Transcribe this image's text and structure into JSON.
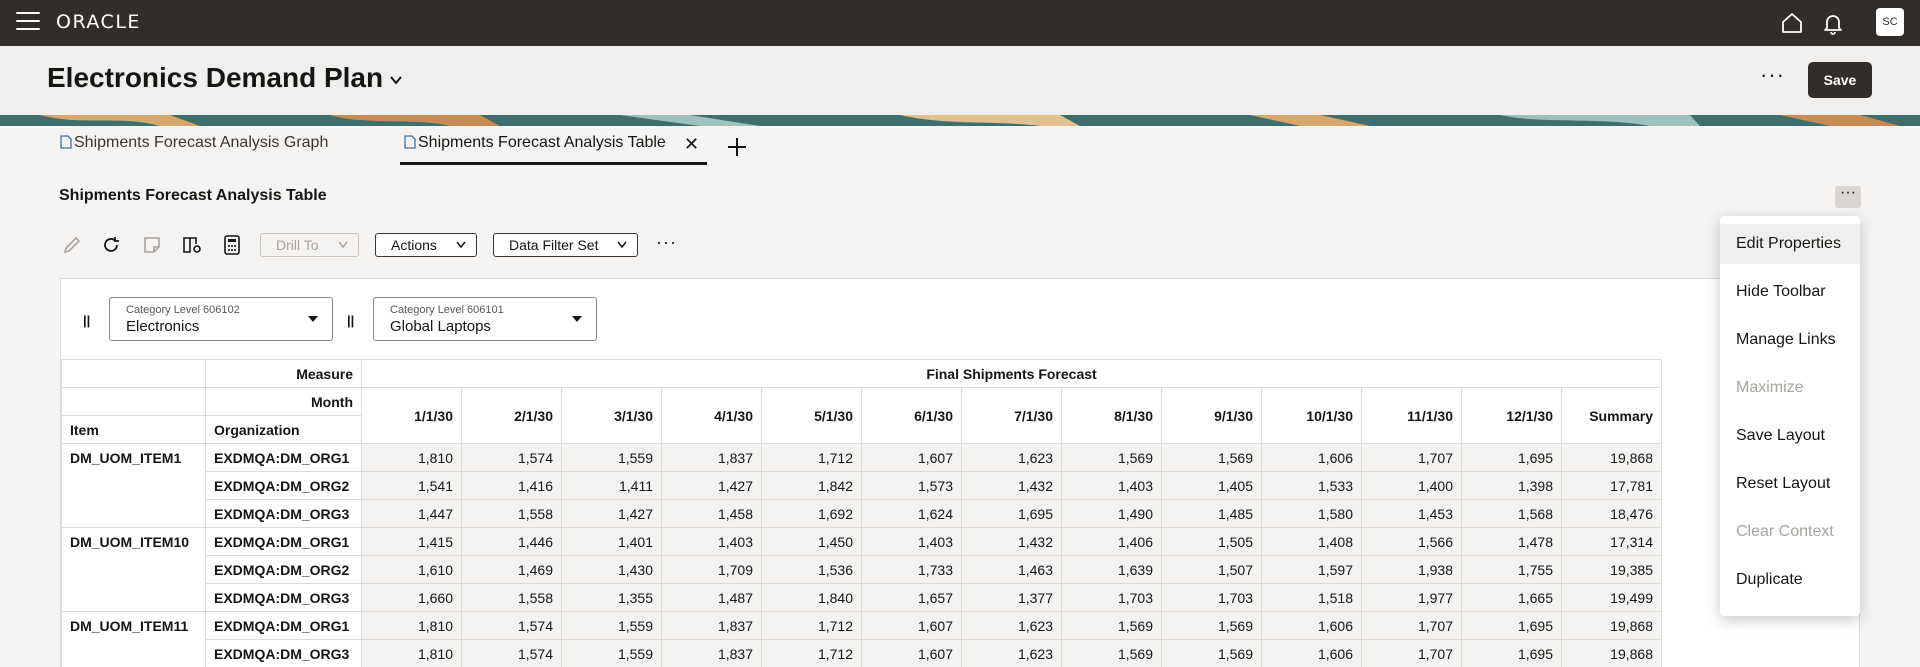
{
  "app": {
    "logo": "ORACLE",
    "user_initials": "SC"
  },
  "header": {
    "title": "Electronics Demand Plan",
    "save_label": "Save"
  },
  "tabs": [
    {
      "label": "Shipments Forecast Analysis Graph"
    },
    {
      "label": "Shipments Forecast Analysis Table"
    }
  ],
  "section": {
    "title": "Shipments Forecast Analysis Table"
  },
  "toolbar": {
    "drill_to": "Drill To",
    "actions": "Actions",
    "data_filter_set": "Data Filter Set"
  },
  "filters": [
    {
      "label": "Category Level 606102",
      "value": "Electronics"
    },
    {
      "label": "Category Level 606101",
      "value": "Global Laptops"
    }
  ],
  "table": {
    "measure_label": "Measure",
    "month_label": "Month",
    "item_label": "Item",
    "org_label": "Organization",
    "measure_name": "Final Shipments Forecast",
    "months": [
      "1/1/30",
      "2/1/30",
      "3/1/30",
      "4/1/30",
      "5/1/30",
      "6/1/30",
      "7/1/30",
      "8/1/30",
      "9/1/30",
      "10/1/30",
      "11/1/30",
      "12/1/30",
      "Summary"
    ],
    "groups": [
      {
        "item": "DM_UOM_ITEM1",
        "rows": [
          {
            "org": "EXDMQA:DM_ORG1",
            "values": [
              "1,810",
              "1,574",
              "1,559",
              "1,837",
              "1,712",
              "1,607",
              "1,623",
              "1,569",
              "1,569",
              "1,606",
              "1,707",
              "1,695",
              "19,868"
            ]
          },
          {
            "org": "EXDMQA:DM_ORG2",
            "values": [
              "1,541",
              "1,416",
              "1,411",
              "1,427",
              "1,842",
              "1,573",
              "1,432",
              "1,403",
              "1,405",
              "1,533",
              "1,400",
              "1,398",
              "17,781"
            ]
          },
          {
            "org": "EXDMQA:DM_ORG3",
            "values": [
              "1,447",
              "1,558",
              "1,427",
              "1,458",
              "1,692",
              "1,624",
              "1,695",
              "1,490",
              "1,485",
              "1,580",
              "1,453",
              "1,568",
              "18,476"
            ]
          }
        ]
      },
      {
        "item": "DM_UOM_ITEM10",
        "rows": [
          {
            "org": "EXDMQA:DM_ORG1",
            "values": [
              "1,415",
              "1,446",
              "1,401",
              "1,403",
              "1,450",
              "1,403",
              "1,432",
              "1,406",
              "1,505",
              "1,408",
              "1,566",
              "1,478",
              "17,314"
            ]
          },
          {
            "org": "EXDMQA:DM_ORG2",
            "values": [
              "1,610",
              "1,469",
              "1,430",
              "1,709",
              "1,536",
              "1,733",
              "1,463",
              "1,639",
              "1,507",
              "1,597",
              "1,938",
              "1,755",
              "19,385"
            ]
          },
          {
            "org": "EXDMQA:DM_ORG3",
            "values": [
              "1,660",
              "1,558",
              "1,355",
              "1,487",
              "1,840",
              "1,657",
              "1,377",
              "1,703",
              "1,703",
              "1,518",
              "1,977",
              "1,665",
              "19,499"
            ]
          }
        ]
      },
      {
        "item": "DM_UOM_ITEM11",
        "rows": [
          {
            "org": "EXDMQA:DM_ORG1",
            "values": [
              "1,810",
              "1,574",
              "1,559",
              "1,837",
              "1,712",
              "1,607",
              "1,623",
              "1,569",
              "1,569",
              "1,606",
              "1,707",
              "1,695",
              "19,868"
            ]
          },
          {
            "org": "EXDMQA:DM_ORG3",
            "values": [
              "1,810",
              "1,574",
              "1,559",
              "1,837",
              "1,712",
              "1,607",
              "1,623",
              "1,569",
              "1,569",
              "1,606",
              "1,707",
              "1,695",
              "19,868"
            ]
          }
        ]
      }
    ]
  },
  "menu": {
    "items": [
      {
        "label": "Edit Properties",
        "state": "hover"
      },
      {
        "label": "Hide Toolbar",
        "state": "enabled"
      },
      {
        "label": "Manage Links",
        "state": "enabled"
      },
      {
        "label": "Maximize",
        "state": "disabled"
      },
      {
        "label": "Save Layout",
        "state": "enabled"
      },
      {
        "label": "Reset Layout",
        "state": "enabled"
      },
      {
        "label": "Clear Context",
        "state": "disabled"
      },
      {
        "label": "Duplicate",
        "state": "enabled"
      }
    ]
  },
  "icons": {
    "menu": "hamburger-icon",
    "home": "home-icon",
    "notifications": "bell-icon",
    "edit": "pencil-icon",
    "refresh": "refresh-icon",
    "note": "note-icon",
    "book": "book-settings-icon",
    "calculator": "calculator-icon"
  },
  "colors": {
    "topbar": "#312d2a",
    "band": "#3f6f6c",
    "save_button": "#312d2a"
  }
}
